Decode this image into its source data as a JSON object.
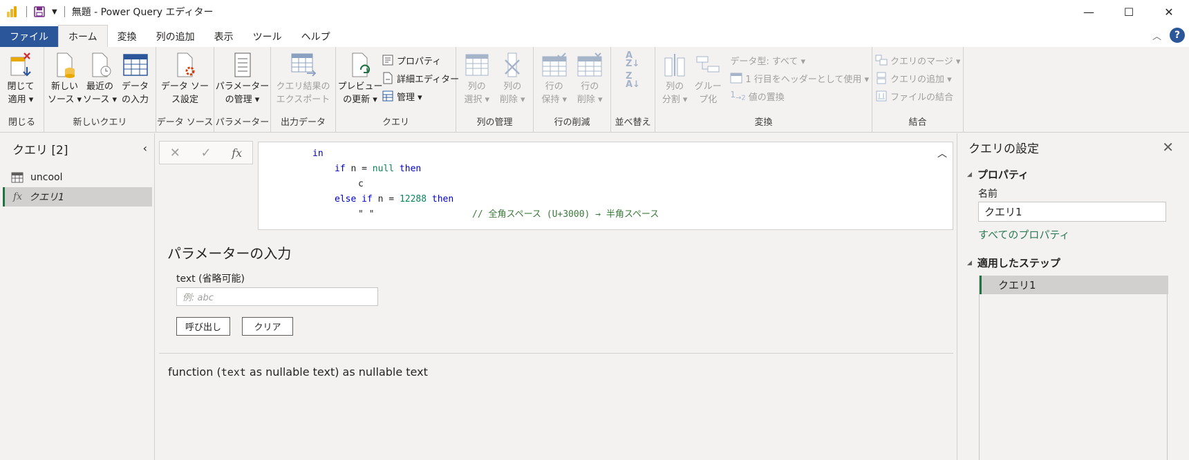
{
  "window": {
    "title": "無題 - Power Query エディター",
    "minimize": "—",
    "maximize": "☐",
    "close": "✕"
  },
  "tabs": [
    "ファイル",
    "ホーム",
    "変換",
    "列の追加",
    "表示",
    "ツール",
    "ヘルプ"
  ],
  "ribbon": {
    "close_group": {
      "label": "閉じる",
      "close_apply": "閉じて\n適用 ▾"
    },
    "new_query": {
      "label": "新しいクエリ",
      "new_source": "新しい\nソース ▾",
      "recent_source": "最近の\nソース ▾",
      "enter_data": "データ\nの入力"
    },
    "data_source": {
      "label": "データ ソース",
      "settings": "データ ソー\nス設定"
    },
    "parameters": {
      "label": "パラメーター",
      "manage": "パラメーター\nの管理 ▾"
    },
    "output": {
      "label": "出力データ",
      "export": "クエリ結果の\nエクスポート"
    },
    "query": {
      "label": "クエリ",
      "refresh": "プレビュー\nの更新 ▾",
      "properties": "プロパティ",
      "advanced_editor": "詳細エディター",
      "manage": "管理 ▾"
    },
    "manage_columns": {
      "label": "列の管理",
      "choose": "列の\n選択 ▾",
      "remove": "列の\n削除 ▾"
    },
    "reduce_rows": {
      "label": "行の削減",
      "keep": "行の\n保持 ▾",
      "remove": "行の\n削除 ▾"
    },
    "sort": {
      "label": "並べ替え"
    },
    "transform": {
      "label": "変換",
      "split": "列の\n分割 ▾",
      "group_by": "グルー\nプ化",
      "data_type": "データ型: すべて ▾",
      "use_header": "1 行目をヘッダーとして使用 ▾",
      "replace_values": "値の置換"
    },
    "combine": {
      "label": "結合",
      "merge": "クエリのマージ ▾",
      "append": "クエリの追加 ▾",
      "combine_files": "ファイルの結合"
    }
  },
  "queries_panel": {
    "title": "クエリ [2]",
    "items": [
      {
        "name": "uncool",
        "icon": "table-icon"
      },
      {
        "name": "クエリ1",
        "icon": "fx-icon"
      }
    ]
  },
  "formula_bar": {
    "cancel": "✕",
    "commit": "✓",
    "fx": "fx"
  },
  "code": {
    "l1_kw": "in",
    "l2_kw1": "if",
    "l2_t1": " n = ",
    "l2_lit": "null",
    "l2_kw2": " then",
    "l3_t": "c",
    "l4_kw1": "else if",
    "l4_t1": " n = ",
    "l4_lit": "12288",
    "l4_kw2": " then",
    "l5_t": "\" \"",
    "l5_cm": "// 全角スペース (U+3000) → 半角スペース"
  },
  "params": {
    "title": "パラメーターの入力",
    "text_label": "text (省略可能)",
    "text_placeholder": "例: abc",
    "invoke": "呼び出し",
    "clear": "クリア",
    "sig_pre": "function (",
    "sig_mono": "text",
    "sig_post": " as nullable text) as nullable text"
  },
  "settings_panel": {
    "title": "クエリの設定",
    "properties_header": "プロパティ",
    "name_label": "名前",
    "name_value": "クエリ1",
    "all_properties": "すべてのプロパティ",
    "steps_header": "適用したステップ",
    "steps": [
      "クエリ1"
    ]
  },
  "colors": {
    "accent": "#2b579a",
    "selected_marker": "#217346",
    "link": "#2b7a55"
  }
}
